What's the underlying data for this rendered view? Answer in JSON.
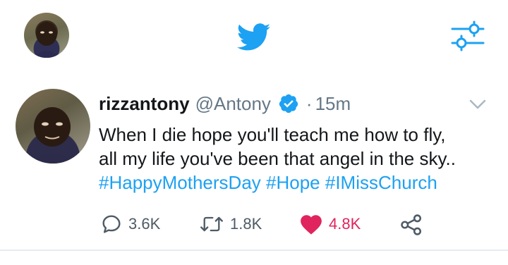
{
  "header": {
    "logo_icon": "twitter-bird-icon",
    "filter_icon": "sliders-icon",
    "brand_color": "#1DA1F2"
  },
  "tweet": {
    "display_name": "rizzantony",
    "handle": "@Antony",
    "separator": "·",
    "time": "15m",
    "text_lines": [
      "When I die hope you'll teach me how to fly,",
      "all my life you've been that angel in the sky.."
    ],
    "hashtags": [
      "#HappyMothersDay",
      "#Hope",
      "#IMissChurch"
    ],
    "actions": {
      "replies": "3.6K",
      "retweets": "1.8K",
      "likes": "4.8K",
      "liked": true
    },
    "colors": {
      "hashtag": "#1DA1F2",
      "like_active": "#E0245E",
      "secondary_text": "#657786"
    }
  }
}
